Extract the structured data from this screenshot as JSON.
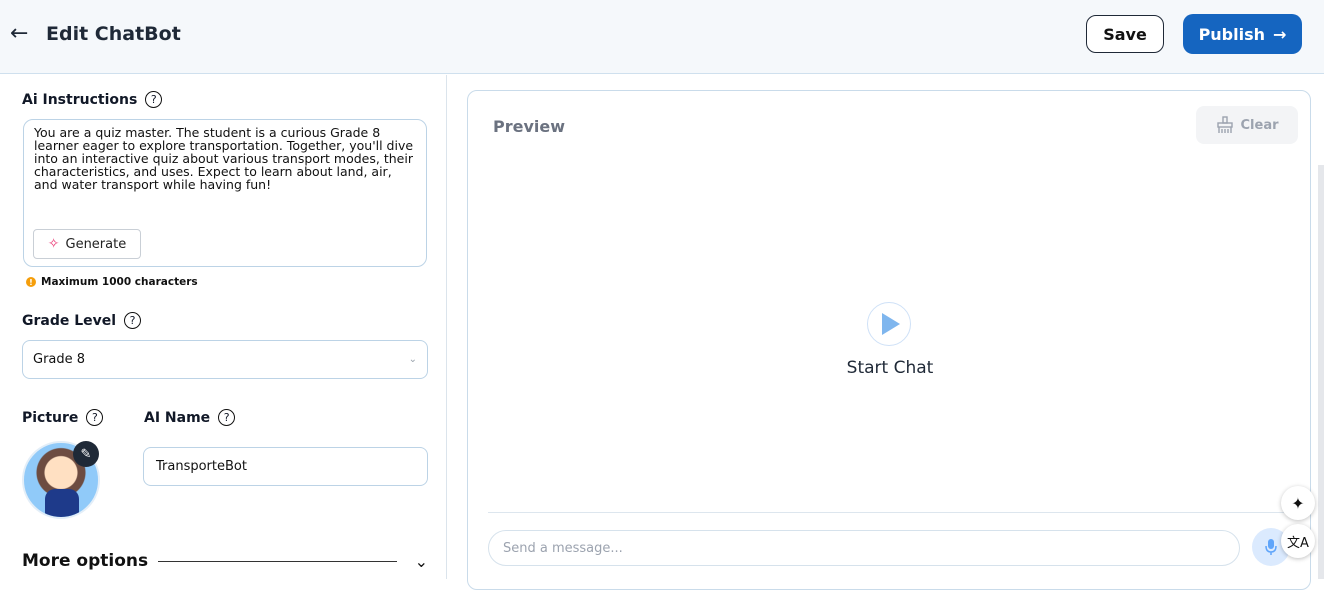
{
  "header": {
    "title": "Edit ChatBot",
    "save_label": "Save",
    "publish_label": "Publish"
  },
  "left": {
    "instructions_label": "Ai Instructions",
    "instructions_text": "You are a quiz master. The student is a curious Grade 8 learner eager to explore transportation. Together, you'll dive into an interactive quiz about various transport modes, their characteristics, and uses. Expect to learn about land, air, and water transport while having fun!",
    "generate_label": "Generate",
    "max_note": "Maximum 1000 characters",
    "grade_label": "Grade Level",
    "grade_value": "Grade 8",
    "picture_label": "Picture",
    "ai_name_label": "AI Name",
    "ai_name_value": "TransporteBot",
    "more_options_label": "More options"
  },
  "preview": {
    "title": "Preview",
    "clear_label": "Clear",
    "start_label": "Start Chat",
    "message_placeholder": "Send a message..."
  },
  "icons": {
    "help": "?",
    "back": "←",
    "publish_arrow": "→"
  },
  "colors": {
    "accent": "#1565c0",
    "panel_border": "#bcd3e6"
  }
}
